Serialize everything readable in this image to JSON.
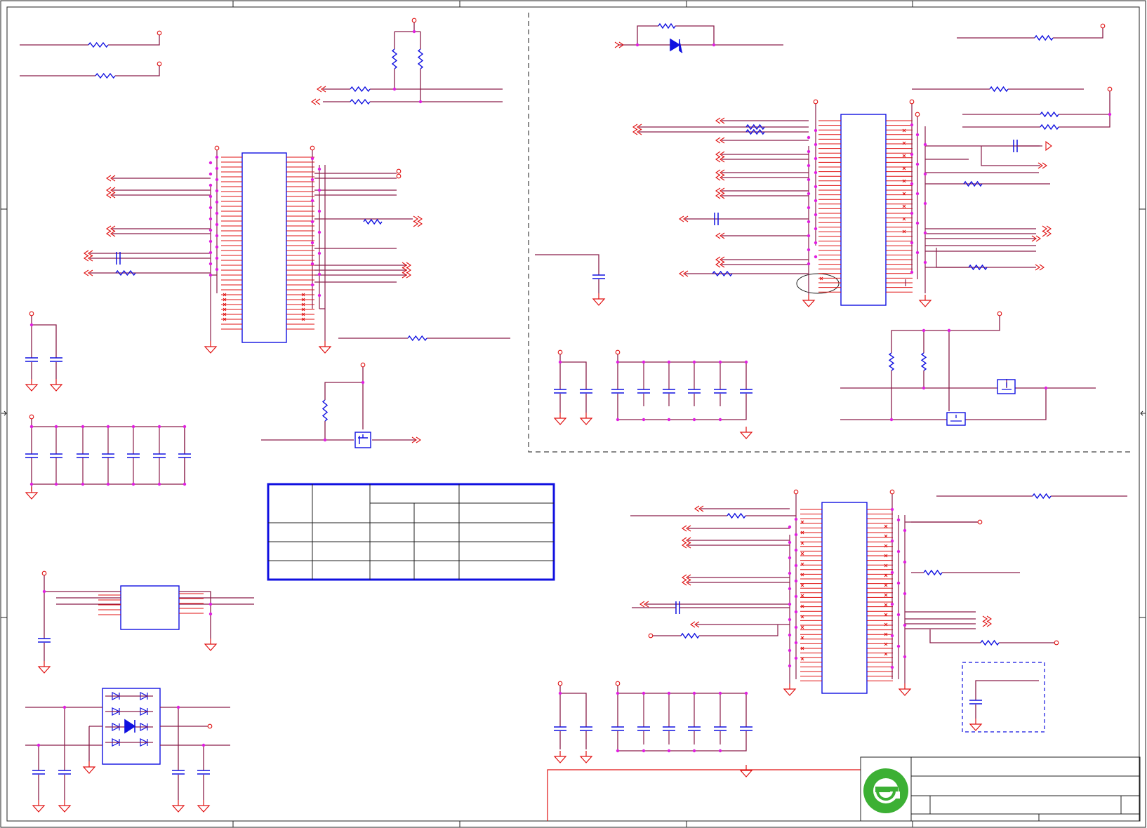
{
  "sheet": {
    "background": "#ffffff",
    "wire_color": "#8a1f4a",
    "pin_color": "#e01010",
    "component_color": "#1010e0",
    "junction_color": "#e020e0"
  },
  "title_block": {
    "logo_icon": "green-circle-e-logo",
    "logo_color": "#3cb034"
  },
  "table": {
    "rows": 5,
    "columns": 5,
    "border_color": "#1010e0"
  }
}
